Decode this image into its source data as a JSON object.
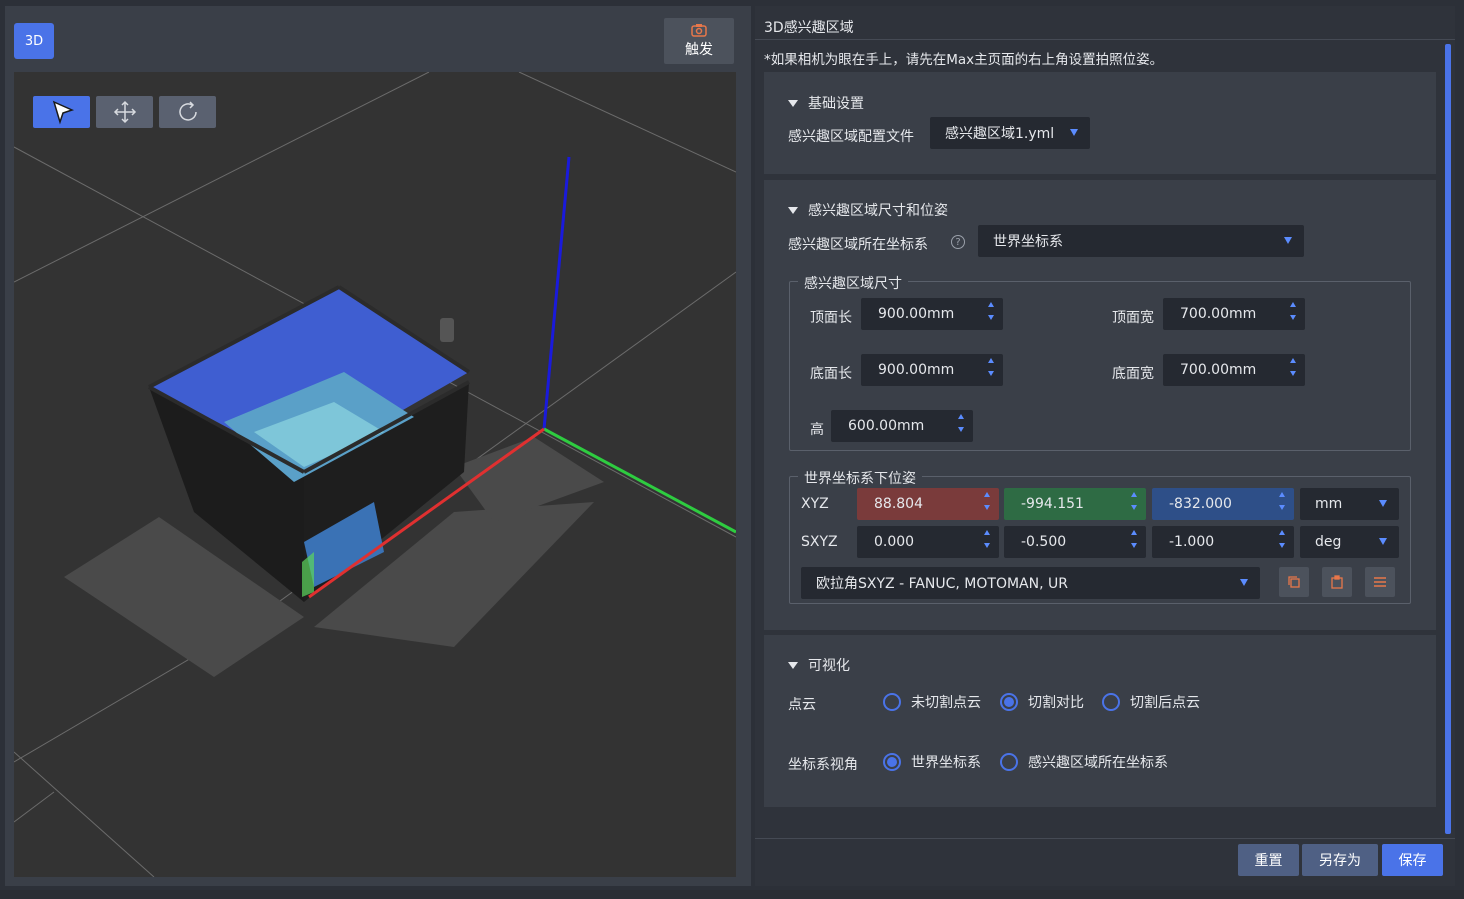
{
  "left": {
    "mode_label": "3D",
    "trigger_label": "触发",
    "icons": [
      "camera-icon",
      "select-arrow-icon",
      "move-icon",
      "rotate-icon"
    ]
  },
  "right": {
    "title": "3D感兴趣区域",
    "note": "*如果相机为眼在手上，请先在Max主页面的右上角设置拍照位姿。",
    "basic": {
      "heading": "基础设置",
      "config_label": "感兴趣区域配置文件",
      "config_value": "感兴趣区域1.yml"
    },
    "size_pose": {
      "heading": "感兴趣区域尺寸和位姿",
      "frame_label": "感兴趣区域所在坐标系",
      "frame_value": "世界坐标系",
      "size_legend": "感兴趣区域尺寸",
      "top_len_label": "顶面长",
      "top_len_value": "900.00mm",
      "top_wid_label": "顶面宽",
      "top_wid_value": "700.00mm",
      "bot_len_label": "底面长",
      "bot_len_value": "900.00mm",
      "bot_wid_label": "底面宽",
      "bot_wid_value": "700.00mm",
      "height_label": "高",
      "height_value": "600.00mm",
      "pose_legend": "世界坐标系下位姿",
      "xyz_label": "XYZ",
      "xyz": [
        "88.804",
        "-994.151",
        "-832.000"
      ],
      "xyz_unit": "mm",
      "sxyz_label": "SXYZ",
      "sxyz": [
        "0.000",
        "-0.500",
        "-1.000"
      ],
      "sxyz_unit": "deg",
      "euler_value": "欧拉角SXYZ - FANUC, MOTOMAN, UR"
    },
    "visual": {
      "heading": "可视化",
      "cloud_label": "点云",
      "cloud_options": [
        "未切割点云",
        "切割对比",
        "切割后点云"
      ],
      "view_label": "坐标系视角",
      "view_options": [
        "世界坐标系",
        "感兴趣区域所在坐标系"
      ]
    },
    "footer": {
      "reset": "重置",
      "save_as": "另存为",
      "save": "保存"
    }
  },
  "colors": {
    "accent": "#4a73e8",
    "x_axis": "#e03030",
    "y_axis": "#2ecc40",
    "z_axis": "#1a1adc"
  }
}
